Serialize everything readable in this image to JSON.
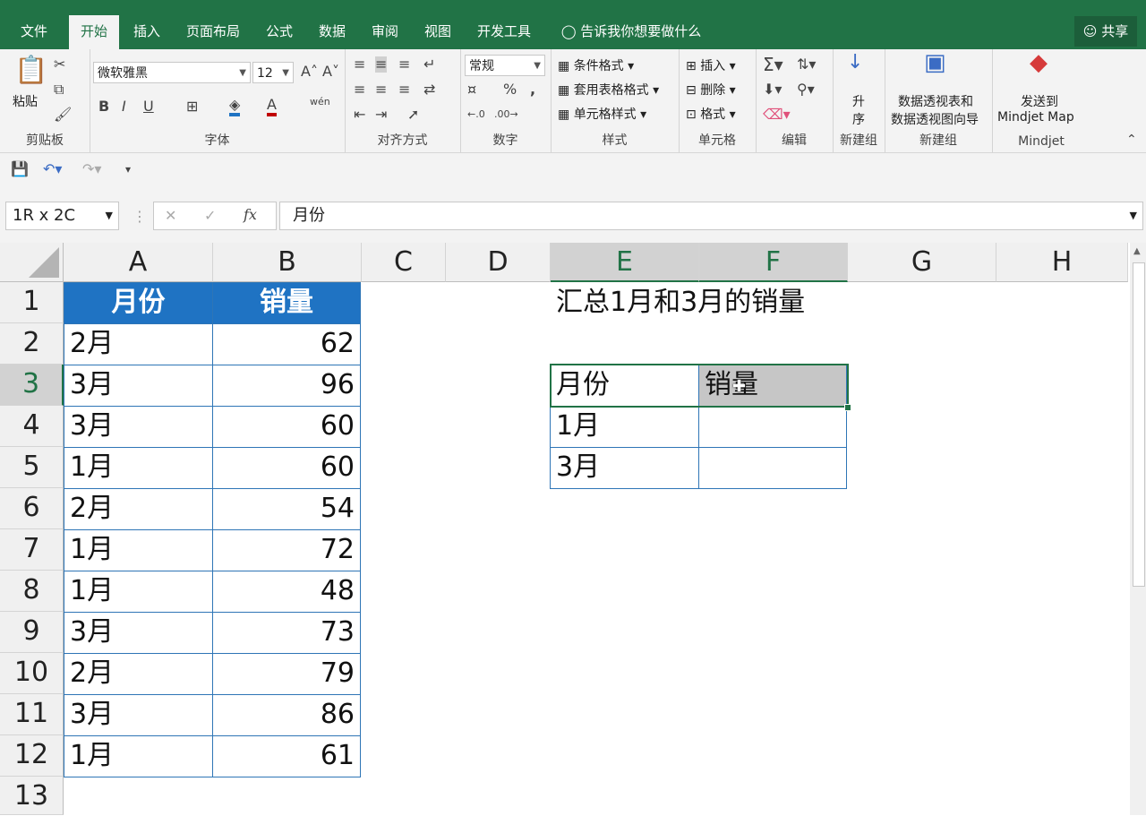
{
  "tabs": [
    "文件",
    "开始",
    "插入",
    "页面布局",
    "公式",
    "数据",
    "审阅",
    "视图",
    "开发工具"
  ],
  "active_tab": "开始",
  "tell_me": "告诉我你想要做什么",
  "share_label": "共享",
  "ribbon": {
    "clipboard": {
      "paste": "粘贴",
      "label": "剪贴板"
    },
    "font": {
      "name": "微软雅黑",
      "size": "12",
      "label": "字体",
      "bold": "B",
      "italic": "I",
      "underline": "U",
      "font_color": "A",
      "phonetic": "wén"
    },
    "alignment": {
      "label": "对齐方式"
    },
    "number": {
      "format": "常规",
      "percent": "%",
      "comma": ",",
      "label": "数字"
    },
    "styles": {
      "conditional": "条件格式",
      "table": "套用表格格式",
      "cell": "单元格样式",
      "label": "样式"
    },
    "cells": {
      "insert": "插入",
      "delete": "删除",
      "format": "格式",
      "label": "单元格"
    },
    "editing": {
      "label": "编辑"
    },
    "sort": {
      "label1": "升",
      "label2": "序",
      "group": "新建组"
    },
    "pivot": {
      "line1": "数据透视表和",
      "line2": "数据透视图向导",
      "group": "新建组"
    },
    "mindjet": {
      "line1": "发送到",
      "line2": "Mindjet Map",
      "group": "Mindjet"
    }
  },
  "namebox": "1R x 2C",
  "formula": "月份",
  "fx": "fx",
  "columns": [
    "A",
    "B",
    "C",
    "D",
    "E",
    "F",
    "G",
    "H"
  ],
  "rows": [
    "1",
    "2",
    "3",
    "4",
    "5",
    "6",
    "7",
    "8",
    "9",
    "10",
    "11",
    "12",
    "13"
  ],
  "table": {
    "header": [
      "月份",
      "销量"
    ],
    "rows": [
      [
        "2月",
        "62"
      ],
      [
        "3月",
        "96"
      ],
      [
        "3月",
        "60"
      ],
      [
        "1月",
        "60"
      ],
      [
        "2月",
        "54"
      ],
      [
        "1月",
        "72"
      ],
      [
        "1月",
        "48"
      ],
      [
        "3月",
        "73"
      ],
      [
        "2月",
        "79"
      ],
      [
        "3月",
        "86"
      ],
      [
        "1月",
        "61"
      ]
    ]
  },
  "summary": {
    "title": "汇总1月和3月的销量",
    "header": [
      "月份",
      "销量"
    ],
    "rows": [
      [
        "1月",
        ""
      ],
      [
        "3月",
        ""
      ]
    ]
  },
  "colors": {
    "excel_green": "#217346",
    "table_header": "#1f73c3",
    "table_border": "#2e75b6"
  }
}
